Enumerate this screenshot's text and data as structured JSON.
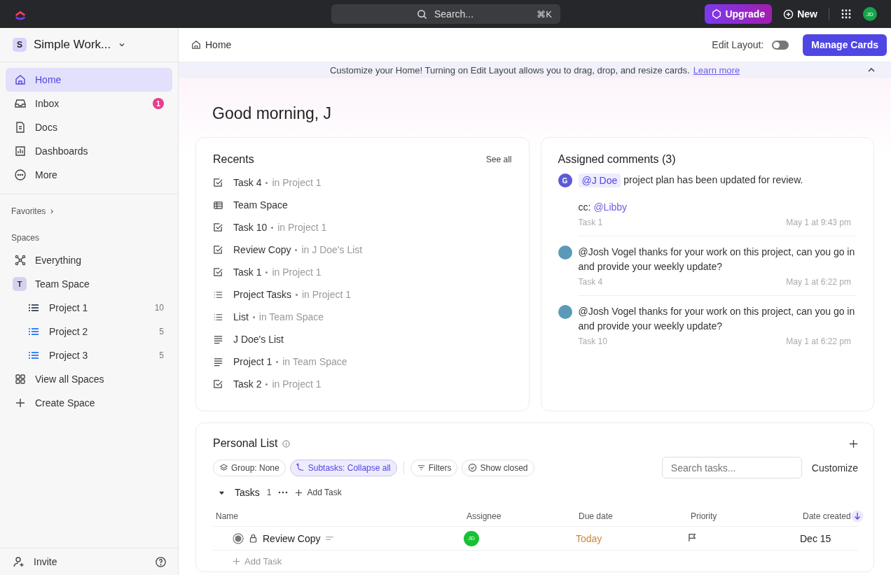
{
  "topbar": {
    "search_placeholder": "Search...",
    "shortcut": "⌘K",
    "upgrade": "Upgrade",
    "new": "New",
    "avatar": "JD"
  },
  "sidebar": {
    "workspace": {
      "initial": "S",
      "name": "Simple Work..."
    },
    "nav": [
      {
        "label": "Home",
        "kind": "home",
        "selected": true
      },
      {
        "label": "Inbox",
        "kind": "inbox",
        "selected": false,
        "badge": "1"
      },
      {
        "label": "Docs",
        "kind": "doc",
        "selected": false
      },
      {
        "label": "Dashboards",
        "kind": "chart",
        "selected": false
      },
      {
        "label": "More",
        "kind": "more",
        "selected": false
      }
    ],
    "favorites": "Favorites",
    "spaces_label": "Spaces",
    "spaces": [
      {
        "label": "Everything",
        "kind": "everything"
      },
      {
        "label": "Team Space",
        "kind": "letter",
        "initial": "T",
        "children": [
          {
            "label": "Project 1",
            "count": "10",
            "color": "#4b5563"
          },
          {
            "label": "Project 2",
            "count": "5",
            "color": "#3b82f6"
          },
          {
            "label": "Project 3",
            "count": "5",
            "color": "#3b82f6"
          }
        ]
      },
      {
        "label": "View all Spaces",
        "kind": "grid"
      },
      {
        "label": "Create Space",
        "kind": "plus"
      }
    ],
    "invite": "Invite"
  },
  "header": {
    "breadcrumb": "Home",
    "edit_layout": "Edit Layout:",
    "edit_layout_on": false,
    "manage": "Manage Cards"
  },
  "banner": {
    "text": "Customize your Home! Turning on Edit Layout allows you to drag, drop, and resize cards.",
    "link": "Learn more"
  },
  "greeting": "Good morning, J",
  "recents": {
    "title": "Recents",
    "see_all": "See all",
    "items": [
      {
        "kind": "task",
        "name": "Task 4",
        "location": "in Project 1"
      },
      {
        "kind": "table",
        "name": "Team Space"
      },
      {
        "kind": "task",
        "name": "Task 10",
        "location": "in Project 1"
      },
      {
        "kind": "task",
        "name": "Review Copy",
        "location": "in J Doe's List"
      },
      {
        "kind": "task",
        "name": "Task 1",
        "location": "in Project 1"
      },
      {
        "kind": "list",
        "name": "Project Tasks",
        "location": "in Project 1"
      },
      {
        "kind": "list",
        "name": "List",
        "location": "in Team Space"
      },
      {
        "kind": "doc",
        "name": "J Doe's List"
      },
      {
        "kind": "doc",
        "name": "Project 1",
        "location": "in Team Space"
      },
      {
        "kind": "task",
        "name": "Task 2",
        "location": "in Project 1"
      }
    ]
  },
  "comments": {
    "title": "Assigned comments (3)",
    "items": [
      {
        "kind": "letter",
        "initial": "G",
        "mention": "@J Doe",
        "text": "project plan has been updated for review.",
        "cc_label": "cc:",
        "cc_mention": "@Libby",
        "task": "Task 1",
        "time": "May 1 at 9:43 pm"
      },
      {
        "kind": "photo",
        "text": "@Josh Vogel thanks for your work on this project, can you go in and provide your weekly update?",
        "task": "Task 4",
        "time": "May 1 at 6:22 pm"
      },
      {
        "kind": "photo",
        "text": "@Josh Vogel thanks for your work on this project, can you go in and provide your weekly update?",
        "task": "Task 10",
        "time": "May 1 at 6:22 pm"
      }
    ]
  },
  "personal_list": {
    "title": "Personal List",
    "chips": [
      {
        "label": "Group: None",
        "kind": "layers",
        "selected": false
      },
      {
        "label": "Subtasks: Collapse all",
        "kind": "subtasks",
        "selected": true
      },
      {
        "label": "Filters",
        "kind": "filter",
        "selected": false
      },
      {
        "label": "Show closed",
        "kind": "check",
        "selected": false
      }
    ],
    "search_placeholder": "Search tasks...",
    "customize": "Customize",
    "group": {
      "name": "Tasks",
      "count": "1",
      "add": "Add Task",
      "expanded": true
    },
    "columns": [
      "Name",
      "Assignee",
      "Due date",
      "Priority",
      "Date created"
    ],
    "rows": [
      {
        "name": "Review Copy",
        "assignee": "JD",
        "due": "Today",
        "created": "Dec 15"
      }
    ],
    "add_task": "Add Task"
  }
}
